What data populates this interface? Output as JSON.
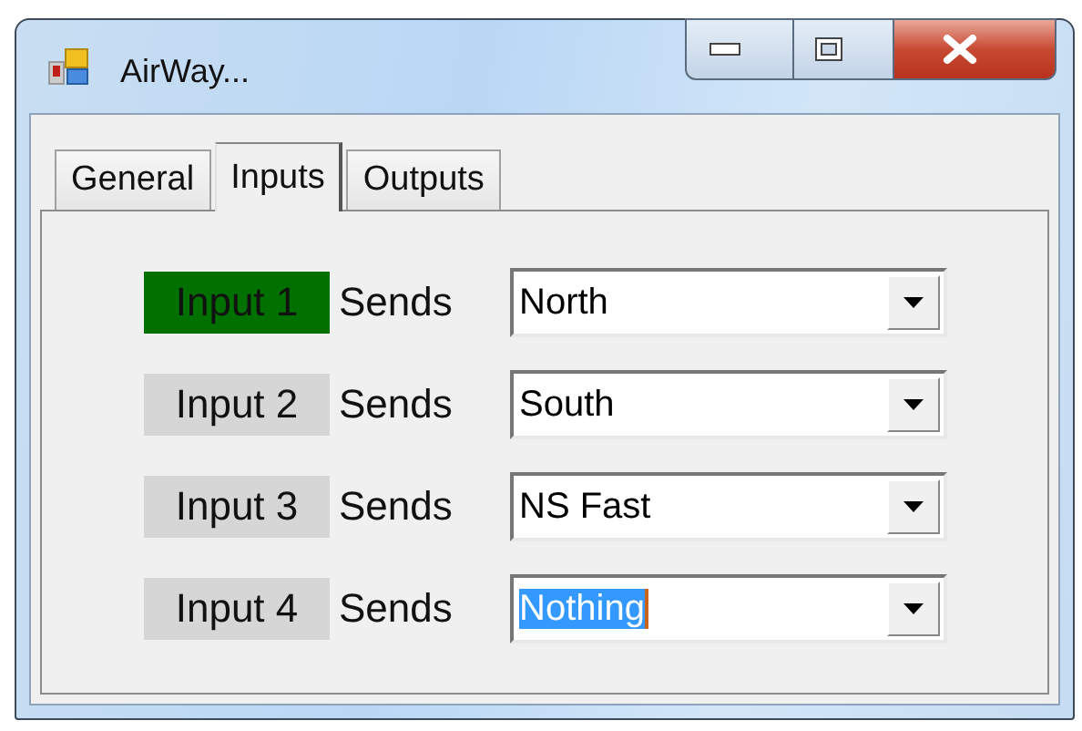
{
  "window": {
    "title": "AirWay..."
  },
  "tabs": [
    {
      "label": "General",
      "selected": false
    },
    {
      "label": "Inputs",
      "selected": true
    },
    {
      "label": "Outputs",
      "selected": false
    }
  ],
  "inputs": [
    {
      "label": "Input 1",
      "active": true,
      "verb": "Sends",
      "value": "North",
      "text_selected": false
    },
    {
      "label": "Input 2",
      "active": false,
      "verb": "Sends",
      "value": "South",
      "text_selected": false
    },
    {
      "label": "Input 3",
      "active": false,
      "verb": "Sends",
      "value": "NS Fast",
      "text_selected": false
    },
    {
      "label": "Input 4",
      "active": false,
      "verb": "Sends",
      "value": "Nothing",
      "text_selected": true
    }
  ]
}
